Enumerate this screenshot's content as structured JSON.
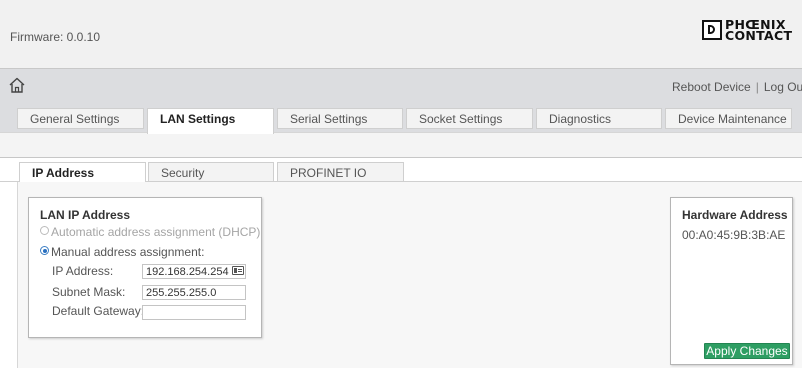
{
  "header": {
    "firmware": "Firmware: 0.0.10",
    "logo_line1": "PHŒNIX",
    "logo_line2": "CONTACT"
  },
  "nav": {
    "home_icon": "home-icon",
    "reboot_label": "Reboot Device",
    "separator": "|",
    "logout_label": "Log Out"
  },
  "main_tabs": [
    {
      "label": "General Settings",
      "active": false
    },
    {
      "label": "LAN Settings",
      "active": true
    },
    {
      "label": "Serial Settings",
      "active": false
    },
    {
      "label": "Socket Settings",
      "active": false
    },
    {
      "label": "Diagnostics",
      "active": false
    },
    {
      "label": "Device Maintenance",
      "active": false
    }
  ],
  "sub_tabs": [
    {
      "label": "IP Address",
      "active": true
    },
    {
      "label": "Security",
      "active": false
    },
    {
      "label": "PROFINET IO",
      "active": false
    }
  ],
  "lan_ip": {
    "title": "LAN IP Address",
    "dhcp_label": "Automatic address assignment (DHCP)",
    "manual_label": "Manual address assignment:",
    "selected_mode": "manual",
    "ip_label": "IP Address:",
    "ip_value": "192.168.254.254",
    "subnet_label": "Subnet Mask:",
    "subnet_value": "255.255.255.0",
    "gateway_label": "Default Gateway:",
    "gateway_value": ""
  },
  "hardware": {
    "title": "Hardware Address",
    "mac": "00:A0:45:9B:3B:AE"
  },
  "apply_label": "Apply Changes",
  "colors": {
    "apply_button": "#2e9e63",
    "radio_selected": "#2a6fbf"
  }
}
